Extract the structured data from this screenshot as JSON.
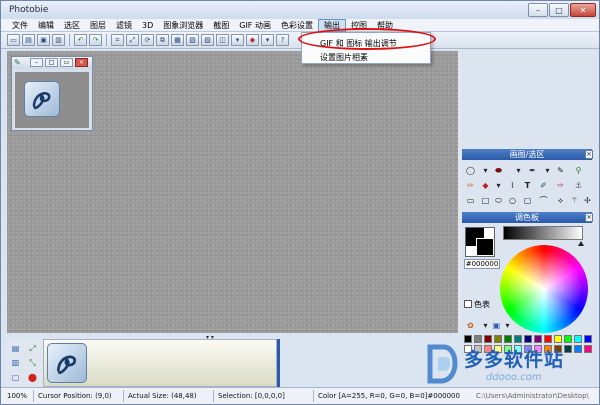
{
  "window": {
    "title": "Photobie",
    "min_label": "–",
    "max_label": "□",
    "close_label": "✕"
  },
  "menu": {
    "items": [
      "文件",
      "编辑",
      "选区",
      "图层",
      "滤镜",
      "3D",
      "图象浏览器",
      "截图",
      "GIF 动画",
      "色彩设置",
      "输出",
      "控图",
      "帮助"
    ],
    "active_index": 10
  },
  "dropdown": {
    "items": [
      "GIF 和 图标 输出调节",
      "设置图片相素"
    ],
    "highlight_color": "#e01010"
  },
  "panels": {
    "draw_title": "画图/选区",
    "palette_title": "调色板",
    "hex_value": "#000000",
    "color_checkbox_label": "色表"
  },
  "status": {
    "zoom": "100%",
    "cursor": "Cursor Position: (9,0)",
    "actual_size": "Actual Size: (48,48)",
    "selection": "Selection: [0,0,0,0]",
    "color": "Color [A=255, R=0, G=0, B=0]#000000",
    "path": "C:\\Users\\Administrator\\Desktop\\"
  },
  "watermark": {
    "brand": "多多软件站",
    "url": "ddooo.com"
  },
  "colors": {
    "accent": "#2a5aa8",
    "workspace": "#9a9a9a"
  }
}
